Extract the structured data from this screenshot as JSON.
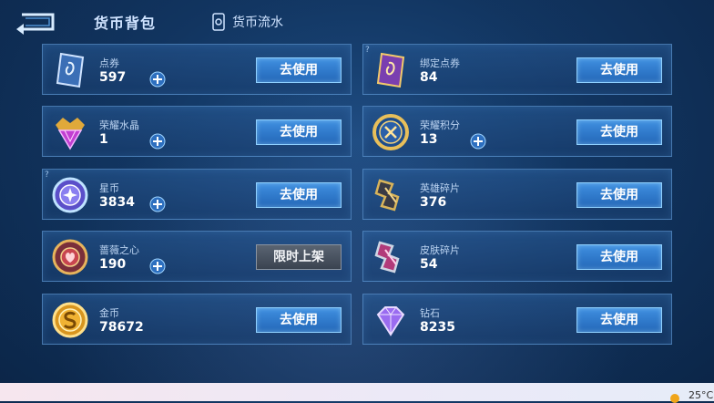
{
  "header": {
    "title": "货币背包",
    "flow_label": "货币流水"
  },
  "currencies": [
    {
      "name": "点券",
      "amount": "597",
      "action": "去使用"
    },
    {
      "name": "绑定点券",
      "amount": "84",
      "action": "去使用"
    },
    {
      "name": "荣耀水晶",
      "amount": "1",
      "action": "去使用"
    },
    {
      "name": "荣耀积分",
      "amount": "13",
      "action": "去使用"
    },
    {
      "name": "星币",
      "amount": "3834",
      "action": "去使用"
    },
    {
      "name": "英雄碎片",
      "amount": "376",
      "action": "去使用"
    },
    {
      "name": "蔷薇之心",
      "amount": "190",
      "action": "限时上架"
    },
    {
      "name": "皮肤碎片",
      "amount": "54",
      "action": "去使用"
    },
    {
      "name": "金币",
      "amount": "78672",
      "action": "去使用"
    },
    {
      "name": "钻石",
      "amount": "8235",
      "action": "去使用"
    }
  ],
  "hint_mark": "?",
  "taskbar": {
    "temperature": "25°C"
  },
  "icons": {
    "back": "back-arrow-icon",
    "flow": "ledger-icon",
    "add": "plus-icon",
    "weather": "sun-icon"
  },
  "colors": {
    "button_blue": "#2f7fd6",
    "button_gray": "#4a5360",
    "panel_border": "#6eaae6",
    "background": "#123763"
  }
}
